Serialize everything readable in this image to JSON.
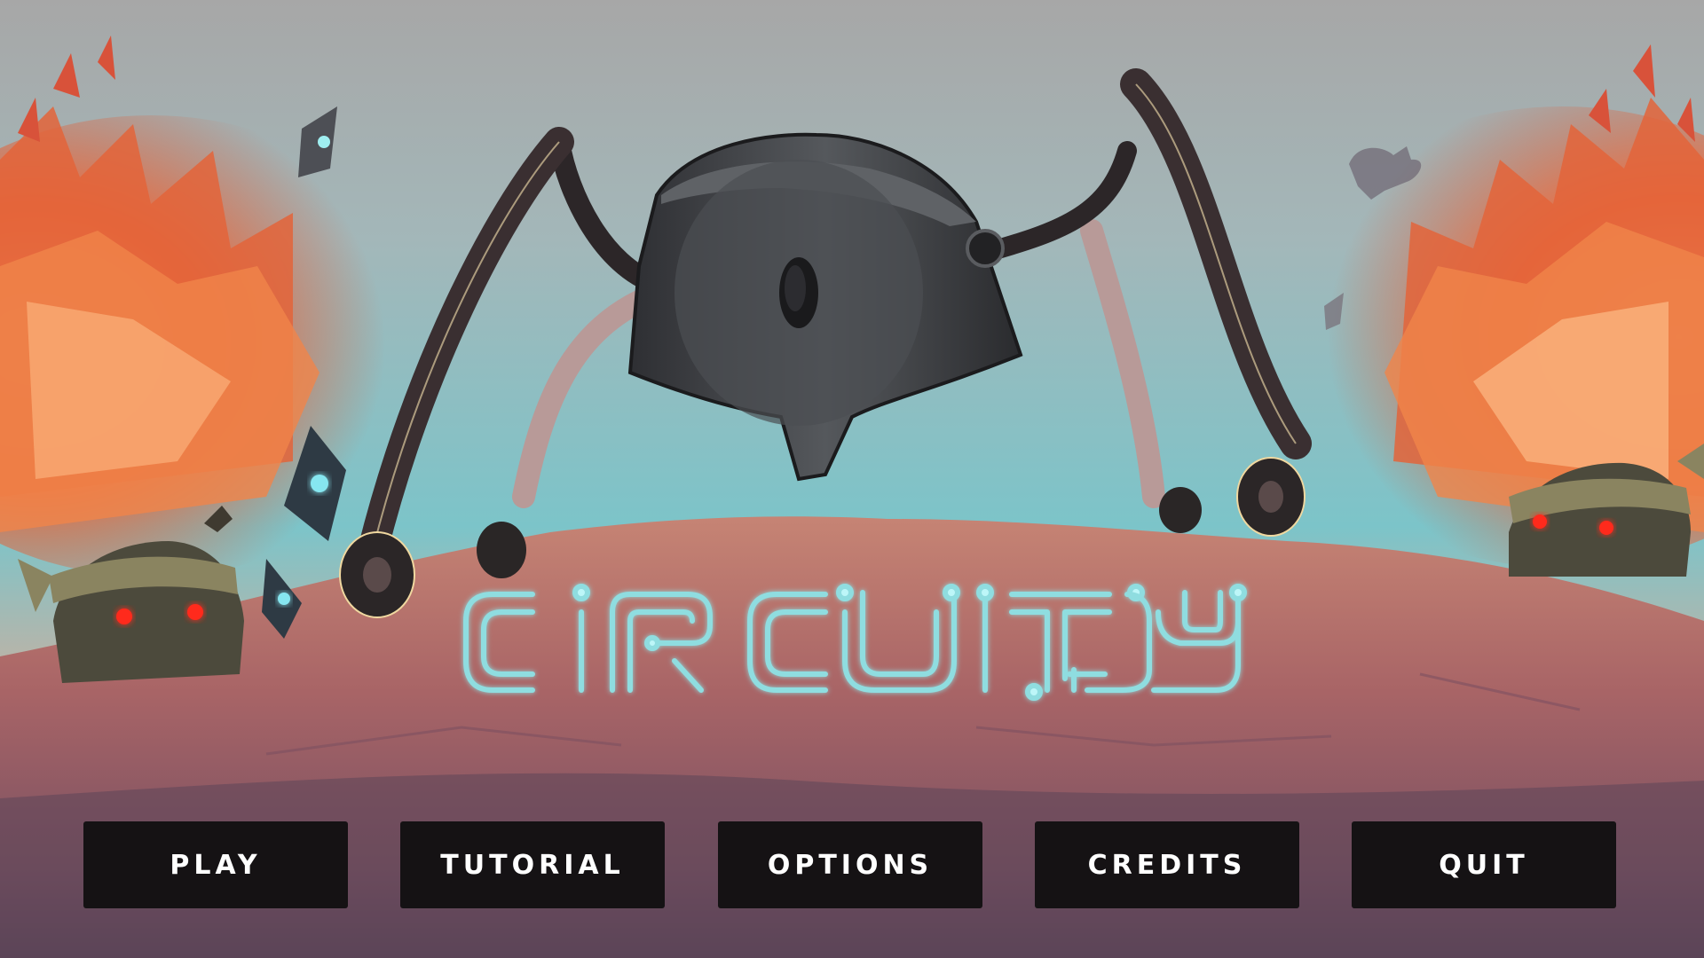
{
  "game": {
    "title": "CIRCUITRY"
  },
  "menu": {
    "buttons": [
      {
        "label": "PLAY"
      },
      {
        "label": "TUTORIAL"
      },
      {
        "label": "OPTIONS"
      },
      {
        "label": "CREDITS"
      },
      {
        "label": "QUIT"
      }
    ]
  },
  "colors": {
    "sky_top": "#a8a8a8",
    "sky_bottom": "#6fc3c9",
    "explosion": "#e8623a",
    "ground": "#b06a6a",
    "logo": "#8fdde0",
    "button_bg": "#151214",
    "button_text": "#ffffff",
    "robot_body": "#3e4043",
    "enemy_eyes": "#ff2a1a"
  },
  "icons": [
    "robot-character",
    "enemy-robot-left",
    "enemy-robot-right",
    "crystal-shard",
    "wrench-icon"
  ]
}
